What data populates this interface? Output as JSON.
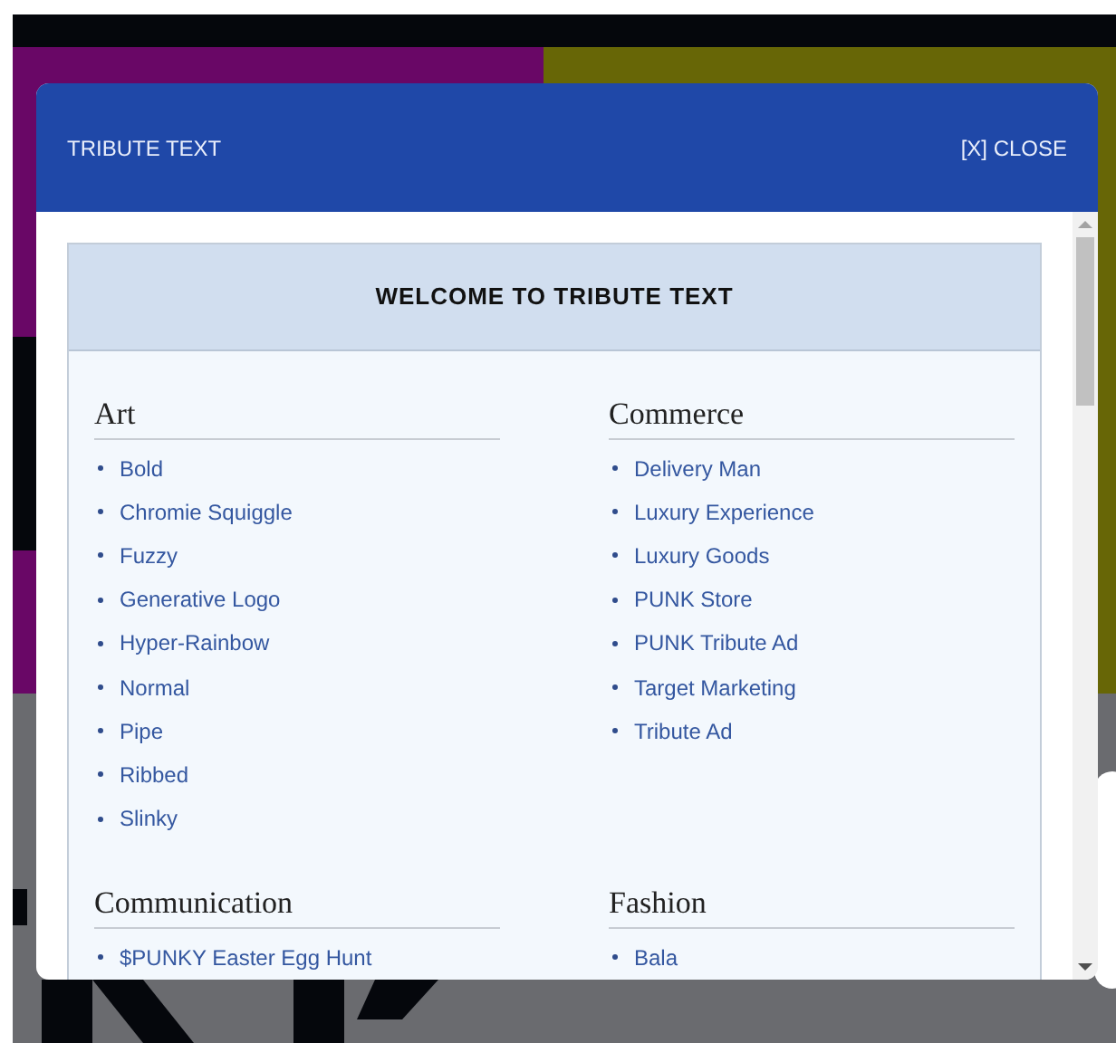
{
  "modal": {
    "title": "TRIBUTE TEXT",
    "close": "[X] CLOSE"
  },
  "panel": {
    "heading": "WELCOME TO TRIBUTE TEXT"
  },
  "categories": [
    {
      "name": "Art",
      "items": [
        "Bold",
        "Chromie Squiggle",
        "Fuzzy",
        "Generative Logo",
        "Hyper-Rainbow",
        "Normal",
        "Pipe",
        "Ribbed",
        "Slinky"
      ]
    },
    {
      "name": "Commerce",
      "items": [
        "Delivery Man",
        "Luxury Experience",
        "Luxury Goods",
        "PUNK Store",
        "PUNK Tribute Ad",
        "Target Marketing",
        "Tribute Ad"
      ]
    },
    {
      "name": "Communication",
      "items": [
        "$PUNKY Easter Egg Hunt"
      ]
    },
    {
      "name": "Fashion",
      "items": [
        "Bala"
      ]
    }
  ]
}
